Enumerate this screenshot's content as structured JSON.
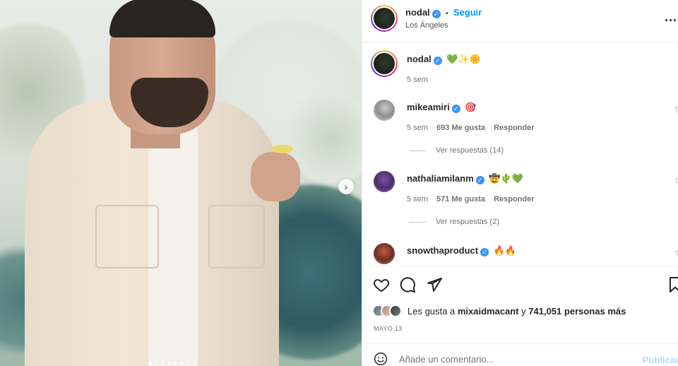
{
  "post": {
    "author": "nodal",
    "follow_label": "Seguir",
    "dot": "•",
    "location": "Los Ángeles",
    "more_label": "..."
  },
  "caption": {
    "username": "nodal",
    "emojis": "💚✨🌼",
    "age": "5 sem"
  },
  "comments": [
    {
      "username": "mikeamiri",
      "emojis": "🎯",
      "age": "5 sem",
      "likes": "693 Me gusta",
      "reply_label": "Responder",
      "view_replies": "Ver respuestas (14)"
    },
    {
      "username": "nathaliamilanm",
      "emojis": "🤠🌵💚",
      "age": "5 sem",
      "likes": "571 Me gusta",
      "reply_label": "Responder",
      "view_replies": "Ver respuestas (2)"
    },
    {
      "username": "snowthaproduct",
      "emojis": "🔥🔥"
    }
  ],
  "likes": {
    "prefix": "Les gusta a",
    "first_user": "mixaidmacant",
    "and": "y",
    "count": "741,051 personas más"
  },
  "date": "MAYO 13",
  "comment_box": {
    "placeholder": "Añade un comentario...",
    "post_label": "Publicar"
  },
  "icons": {
    "verified": "verified-badge",
    "like": "heart-icon",
    "comment": "comment-icon",
    "share": "send-icon",
    "save": "bookmark-icon",
    "emoji": "smile-icon",
    "next": "chevron-right-icon"
  },
  "colors": {
    "accent": "#0095f6",
    "verified": "#3897f0",
    "text": "#262626",
    "muted": "#737373"
  }
}
